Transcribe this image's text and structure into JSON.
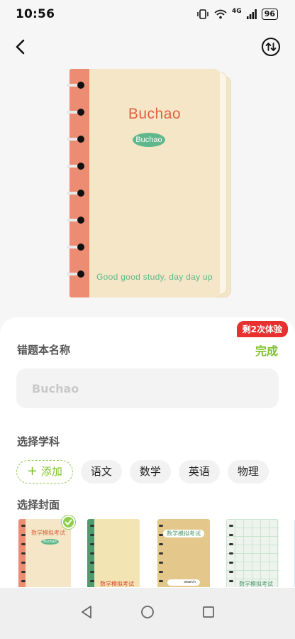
{
  "status_bar": {
    "time": "10:56",
    "network": "4G",
    "battery": "96"
  },
  "header": {
    "back_icon": "chevron-left-icon",
    "switch_icon": "swap-vertical-icon"
  },
  "preview": {
    "title": "Buchao",
    "badge": "Buchao",
    "slogan": "Good good study, day day up",
    "colors": {
      "cover": "#f4e6c7",
      "spine": "#ec8c72",
      "title": "#e0623f",
      "accent": "#5fb88c"
    }
  },
  "trial_badge": "剩2次体验",
  "name_section": {
    "label": "错题本名称",
    "done_label": "完成",
    "input_placeholder": "Buchao",
    "input_value": ""
  },
  "subject_section": {
    "label": "选择学科",
    "add_label": "添加",
    "subjects": [
      "语文",
      "数学",
      "英语",
      "物理"
    ]
  },
  "cover_section": {
    "label": "选择封面",
    "covers": [
      {
        "title": "数学模拟考试",
        "badge": "Buchao",
        "selected": true,
        "color": "#f4e6c7",
        "spine": "#ec8c72"
      },
      {
        "title": "数学模拟考试",
        "selected": false,
        "color": "#f2e4b3",
        "spine": "#4f9a6e"
      },
      {
        "title": "数学模拟考试",
        "search": "search",
        "selected": false,
        "color": "#e4c78a",
        "spine": "#e4c78a"
      },
      {
        "title": "数学模拟考试",
        "selected": false,
        "color": "#eef3ee",
        "spine": "#eef3ee"
      }
    ]
  },
  "nav_bar": {
    "back_icon": "triangle-back-icon",
    "home_icon": "circle-home-icon",
    "recents_icon": "square-recents-icon"
  }
}
